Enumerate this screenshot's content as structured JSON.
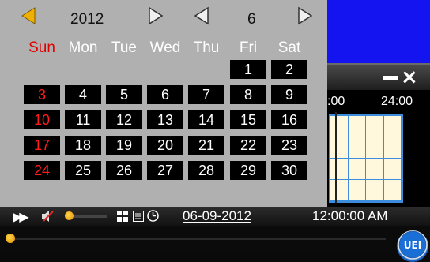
{
  "calendar": {
    "year": "2012",
    "month": "6",
    "weekdays": [
      "Sun",
      "Mon",
      "Tue",
      "Wed",
      "Thu",
      "Fri",
      "Sat"
    ],
    "days": [
      "1",
      "2",
      "3",
      "4",
      "5",
      "6",
      "7",
      "8",
      "9",
      "10",
      "11",
      "12",
      "13",
      "14",
      "15",
      "16",
      "17",
      "18",
      "19",
      "20",
      "21",
      "22",
      "23",
      "24",
      "25",
      "26",
      "27",
      "28",
      "29",
      "30"
    ],
    "colors": {
      "panel": "#b0b0b0",
      "weekday_text": "#ffffff",
      "sunday": "#e00000",
      "cell": "#000000",
      "year_arrow": "#f0b000",
      "month_arrow": "#f0f0f0"
    },
    "icons": {
      "year_prev": "triangle-left-icon",
      "year_next": "triangle-right-icon",
      "month_prev": "triangle-left-icon",
      "month_next": "triangle-right-icon"
    }
  },
  "background_window": {
    "time_start": ":00",
    "time_end": "24:00",
    "colors": {
      "top_panel": "#1414f0",
      "grid_fill": "#fff8dc",
      "grid_line": "#3c8dde"
    },
    "icons": {
      "minimize": "minimize-icon",
      "close": "close-icon"
    }
  },
  "statusbar": {
    "date": "06-09-2012",
    "time": "12:00:00 AM",
    "icons": [
      "fast-forward-icon",
      "mute-icon",
      "window-layout-icon",
      "list-icon",
      "clock-icon"
    ]
  },
  "playbar": {
    "logo_text": "UEI",
    "icons": {
      "knob": "progress-knob-icon",
      "logo": "logo-icon"
    }
  }
}
